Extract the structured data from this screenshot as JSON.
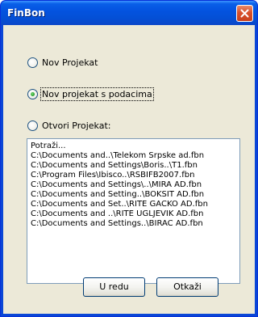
{
  "window": {
    "title": "FinBon"
  },
  "options": {
    "new_project": "Nov Projekat",
    "new_project_with_data": "Nov projekat s podacima",
    "open_project": "Otvori Projekat:"
  },
  "project_list": [
    "Potraži...",
    "C:\\Documents and..\\Telekom Srpske ad.fbn",
    "C:\\Documents and Settings\\Boris..\\T1.fbn",
    "C:\\Program Files\\Ibisco..\\RSBIFB2007.fbn",
    "C:\\Documents and Settings\\..\\MIRA AD.fbn",
    "C:\\Documents and Setting..\\BOKSIT AD.fbn",
    "C:\\Documents and Set..\\RITE GACKO AD.fbn",
    "C:\\Documents and ..\\RITE UGLJEVIK AD.fbn",
    "C:\\Documents and Settings..\\BIRAC AD.fbn"
  ],
  "buttons": {
    "ok": "U redu",
    "cancel": "Otkaži"
  },
  "selected_option": "new_project_with_data"
}
